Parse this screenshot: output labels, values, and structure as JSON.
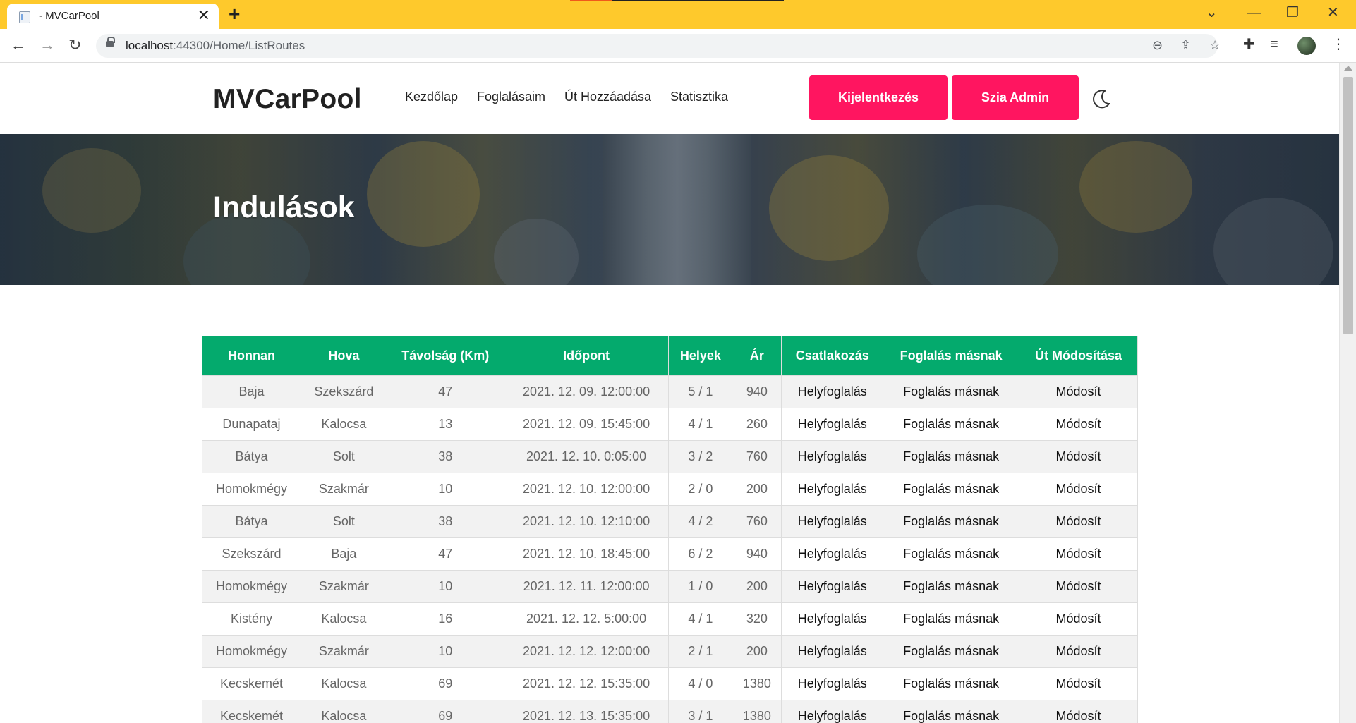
{
  "browser": {
    "tab_title": "- MVCarPool",
    "url_host": "localhost",
    "url_rest": ":44300/Home/ListRoutes"
  },
  "site": {
    "brand": "MVCarPool",
    "nav": [
      "Kezdőlap",
      "Foglalásaim",
      "Út Hozzáadása",
      "Statisztika"
    ],
    "logout_label": "Kijelentkezés",
    "greeting_label": "Szia Admin",
    "accent_color": "#ff1560",
    "table_header_color": "#04aa6d"
  },
  "hero": {
    "title": "Indulások"
  },
  "table": {
    "headers": [
      "Honnan",
      "Hova",
      "Távolság (Km)",
      "Időpont",
      "Helyek",
      "Ár",
      "Csatlakozás",
      "Foglalás másnak",
      "Út Módosítása"
    ],
    "rows": [
      [
        "Baja",
        "Szekszárd",
        "47",
        "2021. 12. 09. 12:00:00",
        "5 / 1",
        "940",
        "Helyfoglalás",
        "Foglalás másnak",
        "Módosít"
      ],
      [
        "Dunapataj",
        "Kalocsa",
        "13",
        "2021. 12. 09. 15:45:00",
        "4 / 1",
        "260",
        "Helyfoglalás",
        "Foglalás másnak",
        "Módosít"
      ],
      [
        "Bátya",
        "Solt",
        "38",
        "2021. 12. 10. 0:05:00",
        "3 / 2",
        "760",
        "Helyfoglalás",
        "Foglalás másnak",
        "Módosít"
      ],
      [
        "Homokmégy",
        "Szakmár",
        "10",
        "2021. 12. 10. 12:00:00",
        "2 / 0",
        "200",
        "Helyfoglalás",
        "Foglalás másnak",
        "Módosít"
      ],
      [
        "Bátya",
        "Solt",
        "38",
        "2021. 12. 10. 12:10:00",
        "4 / 2",
        "760",
        "Helyfoglalás",
        "Foglalás másnak",
        "Módosít"
      ],
      [
        "Szekszárd",
        "Baja",
        "47",
        "2021. 12. 10. 18:45:00",
        "6 / 2",
        "940",
        "Helyfoglalás",
        "Foglalás másnak",
        "Módosít"
      ],
      [
        "Homokmégy",
        "Szakmár",
        "10",
        "2021. 12. 11. 12:00:00",
        "1 / 0",
        "200",
        "Helyfoglalás",
        "Foglalás másnak",
        "Módosít"
      ],
      [
        "Kistény",
        "Kalocsa",
        "16",
        "2021. 12. 12. 5:00:00",
        "4 / 1",
        "320",
        "Helyfoglalás",
        "Foglalás másnak",
        "Módosít"
      ],
      [
        "Homokmégy",
        "Szakmár",
        "10",
        "2021. 12. 12. 12:00:00",
        "2 / 1",
        "200",
        "Helyfoglalás",
        "Foglalás másnak",
        "Módosít"
      ],
      [
        "Kecskemét",
        "Kalocsa",
        "69",
        "2021. 12. 12. 15:35:00",
        "4 / 0",
        "1380",
        "Helyfoglalás",
        "Foglalás másnak",
        "Módosít"
      ],
      [
        "Kecskemét",
        "Kalocsa",
        "69",
        "2021. 12. 13. 15:35:00",
        "3 / 1",
        "1380",
        "Helyfoglalás",
        "Foglalás másnak",
        "Módosít"
      ]
    ]
  }
}
